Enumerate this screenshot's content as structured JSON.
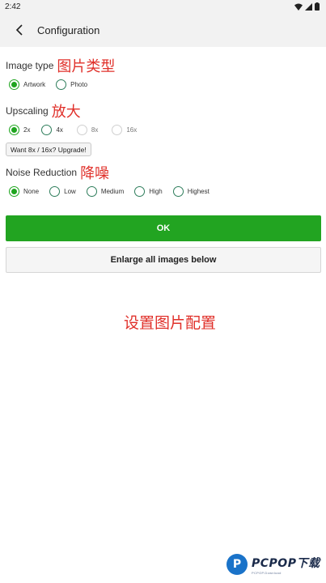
{
  "status_bar": {
    "time": "2:42"
  },
  "app_bar": {
    "title": "Configuration"
  },
  "image_type": {
    "label": "Image type",
    "annotation": "图片类型",
    "options": [
      {
        "label": "Artwork",
        "checked": true
      },
      {
        "label": "Photo",
        "checked": false
      }
    ]
  },
  "upscaling": {
    "label": "Upscaling",
    "annotation": "放大",
    "options": [
      {
        "label": "2x",
        "checked": true,
        "disabled": false
      },
      {
        "label": "4x",
        "checked": false,
        "disabled": false
      },
      {
        "label": "8x",
        "checked": false,
        "disabled": true
      },
      {
        "label": "16x",
        "checked": false,
        "disabled": true
      }
    ],
    "upgrade_label": "Want 8x / 16x? Upgrade!"
  },
  "noise_reduction": {
    "label": "Noise Reduction",
    "annotation": "降噪",
    "options": [
      {
        "label": "None",
        "checked": true
      },
      {
        "label": "Low",
        "checked": false
      },
      {
        "label": "Medium",
        "checked": false
      },
      {
        "label": "High",
        "checked": false
      },
      {
        "label": "Highest",
        "checked": false
      }
    ]
  },
  "buttons": {
    "ok_label": "OK",
    "enlarge_label": "Enlarge all images below"
  },
  "caption": "设置图片配置",
  "watermark": {
    "main": "PCPOP下载",
    "sub": "PCPOP.Download"
  },
  "colors": {
    "accent_green": "#22a421",
    "annotation_red": "#e0302a",
    "radio_border": "#2e7d5b"
  }
}
